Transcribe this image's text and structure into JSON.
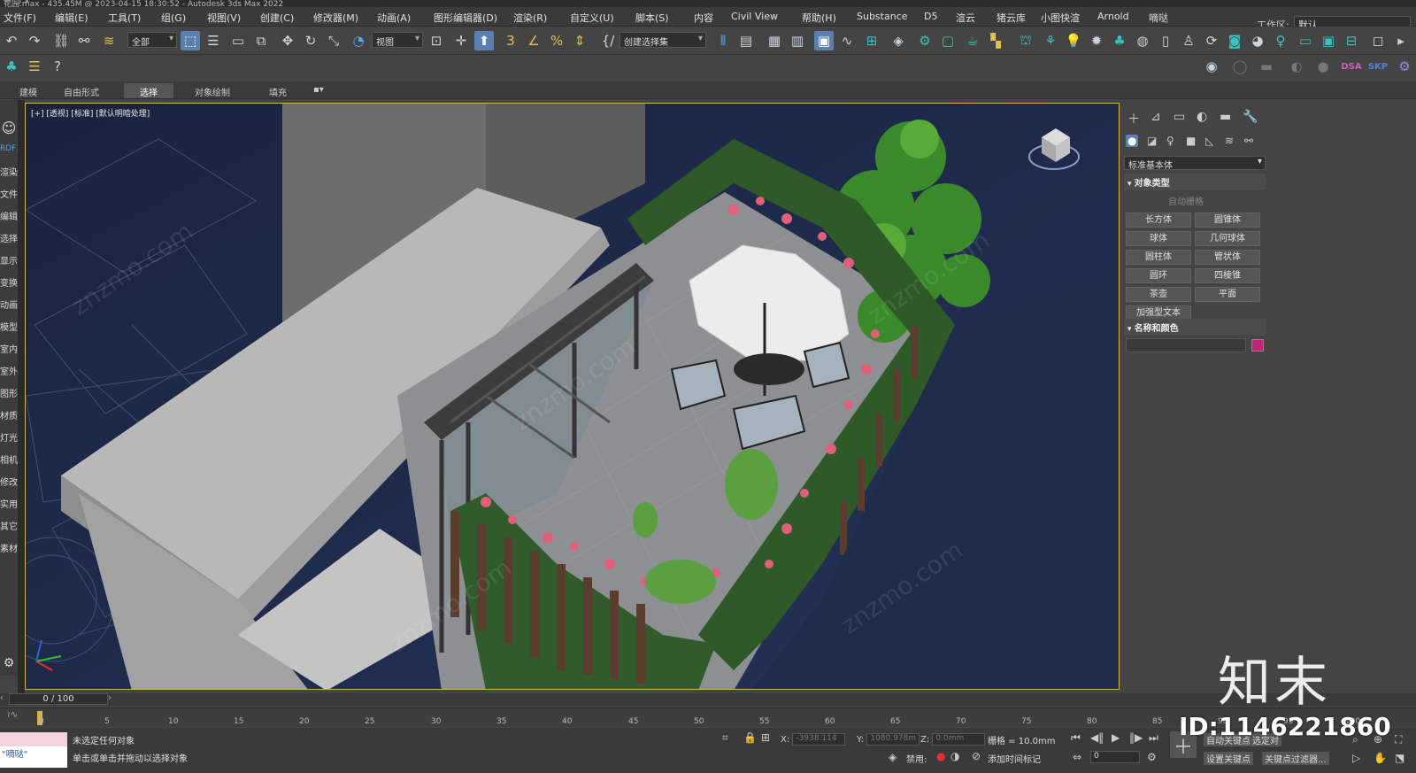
{
  "window": {
    "title": "花园.max - 435.45M @ 2023-04-15 18:30:52 - Autodesk 3ds Max 2022"
  },
  "menu": [
    "文件(F)",
    "编辑(E)",
    "工具(T)",
    "组(G)",
    "视图(V)",
    "创建(C)",
    "修改器(M)",
    "动画(A)",
    "图形编辑器(D)",
    "渲染(R)",
    "自定义(U)",
    "脚本(S)",
    "内容",
    "Civil View",
    "帮助(H)",
    "Substance",
    "D5",
    "渲云",
    "猪云库",
    "小图快渲",
    "Arnold",
    "嘀哒"
  ],
  "workspace": {
    "label": "工作区:",
    "value": "默认"
  },
  "toolbar": {
    "filter": "全部",
    "refcoord": "视图",
    "selset": "创建选择集"
  },
  "ribbon_tabs": [
    "建模",
    "自由形式",
    "选择",
    "对象绘制",
    "填充"
  ],
  "ribbon_active": "选择",
  "left_menu": [
    "RDF3",
    "渲染",
    "文件",
    "编辑",
    "选择",
    "显示",
    "变换",
    "动画",
    "模型",
    "室内",
    "室外",
    "图形",
    "材质",
    "灯光",
    "相机",
    "修改",
    "实用",
    "其它",
    "素材"
  ],
  "viewport": {
    "label": "[+] [透视] [标准] [默认明暗处理]"
  },
  "command_panel": {
    "category": "标准基本体",
    "rollout_object_type": "对象类型",
    "autogrid": "自动栅格",
    "primitives": [
      "长方体",
      "圆锥体",
      "球体",
      "几何球体",
      "圆柱体",
      "管状体",
      "圆环",
      "四棱锥",
      "茶壶",
      "平面",
      "加强型文本"
    ],
    "rollout_name_color": "名称和颜色",
    "object_color": "#c0247a"
  },
  "timeline": {
    "frame": "0 / 100",
    "ticks": [
      "0",
      "5",
      "10",
      "15",
      "20",
      "25",
      "30",
      "35",
      "40",
      "45",
      "50",
      "55",
      "60",
      "65",
      "70",
      "75",
      "80",
      "85",
      "90",
      "95",
      "100"
    ]
  },
  "status": {
    "maxscript": "\"嘀哒\"",
    "line1": "未选定任何对象",
    "line2": "单击或单击并拖动以选择对象",
    "x_label": "X:",
    "x_value": "-3938.114",
    "y_label": "Y:",
    "y_value": "1080.978m",
    "z_label": "Z:",
    "z_value": "0.0mm",
    "grid": "栅格 = 10.0mm",
    "disabled": "禁用:",
    "add_time_tag": "添加时间标记",
    "auto_key": "自动关键点",
    "set_key": "设置关键点",
    "selected": "选定对",
    "key_filters": "关键点过滤器..."
  },
  "watermark": {
    "brand": "知末",
    "id": "ID:1146221860",
    "site": "znzmo.com"
  }
}
